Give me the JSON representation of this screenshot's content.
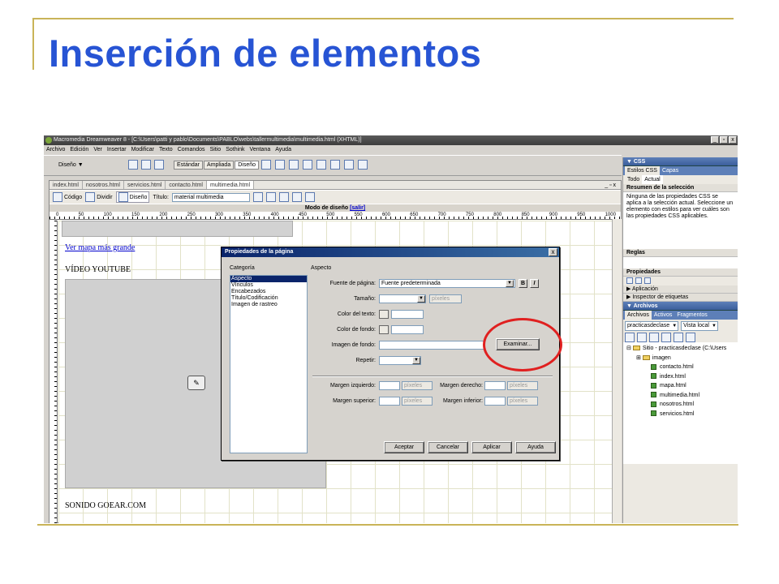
{
  "slide": {
    "title": "Inserción de elementos"
  },
  "colors": {
    "title": "#2754d4",
    "accent_gold": "#c9b458",
    "highlight_circle": "#e02020"
  },
  "app": {
    "window_title": "Macromedia Dreamweaver 8 - [C:\\Users\\patti y pablo\\Documents\\PABLO\\webs\\tallermultimedia\\multimedia.html (XHTML)]",
    "window_buttons": [
      "_",
      "▫",
      "x"
    ],
    "menu": [
      "Archivo",
      "Edición",
      "Ver",
      "Insertar",
      "Modificar",
      "Texto",
      "Comandos",
      "Sitio",
      "Sothink",
      "Ventana",
      "Ayuda"
    ],
    "toolbar": {
      "category": "Diseño",
      "modes": [
        "Estándar",
        "Ampliada",
        "Diseño"
      ]
    },
    "doc_tabs": [
      "index.html",
      "nosotros.html",
      "servicios.html",
      "contacto.html",
      "multimedia.html"
    ],
    "doc_controls": "_ ▫ x",
    "doc_toolbar": {
      "code": "Código",
      "split": "Dividir",
      "design": "Diseño",
      "title_label": "Título:",
      "title_value": "material multimedia"
    },
    "mode_bar": {
      "text": "Modo de diseño",
      "exit": "[salir]"
    },
    "ruler_marks": [
      "0",
      "50",
      "100",
      "150",
      "200",
      "250",
      "300",
      "350",
      "400",
      "450",
      "500",
      "550",
      "600",
      "650",
      "700",
      "750",
      "800",
      "850",
      "900",
      "950",
      "1000"
    ],
    "page": {
      "link": "Ver mapa más grande",
      "video_label": "VÍDEO YOUTUBE",
      "audio_label": "SONIDO GOEAR.COM"
    }
  },
  "css_panel": {
    "header": "▼ CSS",
    "tabs": [
      "Estilos CSS",
      "Capas"
    ],
    "subtabs": [
      "Todo",
      "Actual"
    ],
    "summary_title": "Resumen de la selección",
    "summary_text": "Ninguna de las propiedades CSS se aplica a la selección actual. Seleccione un elemento con estilos para ver cuáles son las propiedades CSS aplicables.",
    "rules_label": "Reglas",
    "properties_label": "Propiedades",
    "application": "▶ Aplicación",
    "tag_inspector": "▶ Inspector de etiquetas"
  },
  "files_panel": {
    "header": "▼ Archivos",
    "tabs": [
      "Archivos",
      "Activos",
      "Fragmentos"
    ],
    "site_select": "practicasdeclase",
    "view_select": "Vista local",
    "root": "Sitio - practicasdeclase (C:\\Users",
    "folder": "imagen",
    "files": [
      "contacto.html",
      "index.html",
      "mapa.html",
      "multimedia.html",
      "nosotros.html",
      "servicios.html"
    ]
  },
  "dialog": {
    "title": "Propiedades de la página",
    "close": "x",
    "category_label": "Categoría",
    "section_label": "Aspecto",
    "categories": [
      "Aspecto",
      "Vínculos",
      "Encabezados",
      "Título/Codificación",
      "Imagen de rastreo"
    ],
    "selected_category": "Aspecto",
    "font_label": "Fuente de página:",
    "font_value": "Fuente predeterminada",
    "bold": "B",
    "italic": "I",
    "size_label": "Tamaño:",
    "unit": "píxeles",
    "text_color_label": "Color del texto:",
    "bg_color_label": "Color de fondo:",
    "bg_image_label": "Imagen de fondo:",
    "browse_button": "Examinar...",
    "repeat_label": "Repetir:",
    "margin_left_label": "Margen izquierdo:",
    "margin_right_label": "Margen derecho:",
    "margin_top_label": "Margen superior:",
    "margin_bottom_label": "Margen inferior:",
    "buttons": {
      "ok": "Aceptar",
      "cancel": "Cancelar",
      "apply": "Aplicar",
      "help": "Ayuda"
    }
  }
}
